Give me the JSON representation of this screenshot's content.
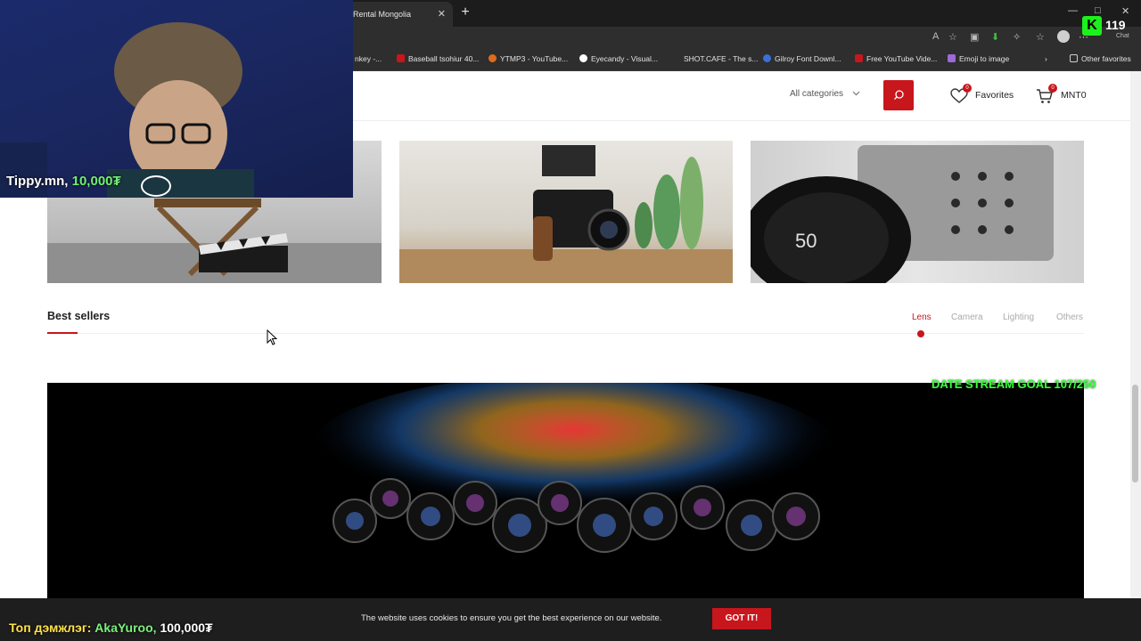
{
  "browser": {
    "tab_title": "Rental Mongolia",
    "tab_close": "✕",
    "new_tab": "+",
    "bookmarks": [
      {
        "label": "nkey -...",
        "color": "#888888"
      },
      {
        "label": "Baseball tsohiur 40...",
        "color": "#c8161d"
      },
      {
        "label": "YTMP3 - YouTube...",
        "color": "#e06b1a"
      },
      {
        "label": "Eyecandy - Visual...",
        "color": "#ffffff"
      },
      {
        "label": "SHOT.CAFE - The s...",
        "color": "#2e2e2e"
      },
      {
        "label": "Gilroy Font Downl...",
        "color": "#3b6fd6"
      },
      {
        "label": "Free YouTube Vide...",
        "color": "#c8161d"
      },
      {
        "label": "Emoji to image",
        "color": "#9b6bd6"
      }
    ],
    "other_favorites": "Other favorites",
    "chat_label": "Chat"
  },
  "header": {
    "category_select": "All categories",
    "favorites_label": "Favorites",
    "favorites_count": "0",
    "cart_label": "MNT0",
    "cart_count": "0"
  },
  "banners": {
    "lens_mark": "50"
  },
  "best_sellers": {
    "title": "Best sellers",
    "tabs": [
      "Lens",
      "Camera",
      "Lighting",
      "Others"
    ],
    "active_tab": "Lens"
  },
  "cookie": {
    "text": "The website uses cookies to ensure you get the best experience on our website.",
    "button": "GOT IT!"
  },
  "overlay": {
    "donor": "Tippy.mn,",
    "donor_amount": "10,000₮",
    "goal": "DATE STREAM GOAL 107/250",
    "top_label": "Топ дэмжлэг:",
    "top_name": "AkaYuroo,",
    "top_amount": "100,000₮",
    "viewer_count": "119",
    "kick_letter": "K"
  },
  "colors": {
    "accent": "#c8161d",
    "goal_green": "#3cff3c"
  }
}
